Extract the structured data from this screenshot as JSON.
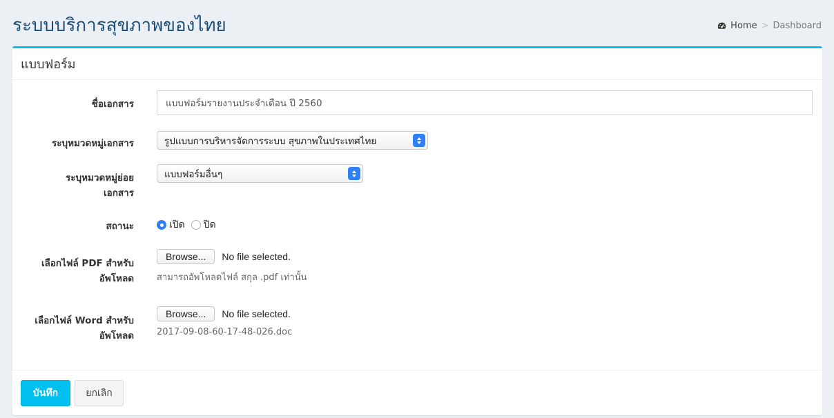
{
  "header": {
    "title": "ระบบบริการสุขภาพของไทย",
    "breadcrumb": {
      "home_label": "Home",
      "separator": ">",
      "current_label": "Dashboard",
      "home_icon": "dashboard-icon"
    }
  },
  "form": {
    "box_title": "แบบฟอร์ม",
    "fields": {
      "doc_name": {
        "label": "ชื่อเอกสาร",
        "value": "แบบฟอร์มรายงานประจำเดือน ปี 2560"
      },
      "category": {
        "label": "ระบุหมวดหมู่เอกสาร",
        "selected": "รูปแบบการบริหารจัดการระบบ สุขภาพในประเทศไทย"
      },
      "subcategory": {
        "label_line1": "ระบุหมวดหมู่ย่อย",
        "label_line2": "เอกสาร",
        "selected": "แบบฟอร์มอื่นๆ"
      },
      "status": {
        "label": "สถานะ",
        "option_on": "เปิด",
        "option_off": "ปิด",
        "selected": "เปิด"
      },
      "pdf_file": {
        "label_line1": "เลือกไฟล์ PDF สำหรับ",
        "label_line2": "อัพโหลด",
        "browse_label": "Browse...",
        "file_status": "No file selected.",
        "help": "สามารถอัพโหลดไฟล์ สกุล .pdf เท่านั้น"
      },
      "word_file": {
        "label_line1": "เลือกไฟล์ Word สำหรับ",
        "label_line2": "อัพโหลด",
        "browse_label": "Browse...",
        "file_status": "No file selected.",
        "help": "2017-09-08-60-17-48-026.doc"
      }
    },
    "buttons": {
      "save_label": "บันทึก",
      "cancel_label": "ยกเลิก"
    }
  },
  "colors": {
    "accent": "#00c0ef",
    "title": "#1b4f7a",
    "background": "#ecf0f5",
    "select_caret": "#2f7ff6"
  }
}
